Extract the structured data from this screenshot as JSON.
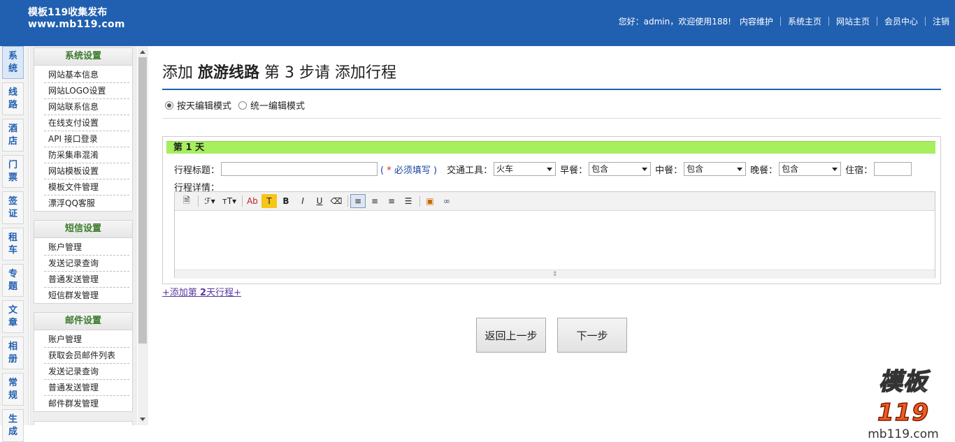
{
  "header": {
    "logo_line1": "模板119收集发布",
    "logo_line2": "www.mb119.com",
    "greeting": "您好：admin，欢迎使用188!",
    "nav": [
      "内容维护",
      "系统主页",
      "网站主页",
      "会员中心",
      "注销"
    ]
  },
  "vtabs": [
    "系统",
    "线路",
    "酒店",
    "门票",
    "签证",
    "租车",
    "专题",
    "文章",
    "相册",
    "常规",
    "生成"
  ],
  "menu": {
    "groups": [
      {
        "title": "系统设置",
        "items": [
          "网站基本信息",
          "网站LOGO设置",
          "网站联系信息",
          "在线支付设置",
          "API 接口登录",
          "防采集串混淆",
          "网站模板设置",
          "模板文件管理",
          "漂浮QQ客服"
        ]
      },
      {
        "title": "短信设置",
        "items": [
          "账户管理",
          "发送记录查询",
          "普通发送管理",
          "短信群发管理"
        ]
      },
      {
        "title": "邮件设置",
        "items": [
          "账户管理",
          "获取会员邮件列表",
          "发送记录查询",
          "普通发送管理",
          "邮件群发管理"
        ]
      }
    ]
  },
  "main": {
    "title_pre": "添加",
    "title_bold": "旅游线路",
    "title_post": "第 3 步请 添加行程",
    "mode_day": "按天编辑模式",
    "mode_all": "统一编辑模式",
    "day_head": "第 1 天",
    "field_title": "行程标题：",
    "req_star": "*",
    "req_text": "必须填写",
    "req_open": "(",
    "req_close": ")",
    "transport_label": "交通工具：",
    "transport_value": "火车",
    "breakfast_label": "早餐：",
    "breakfast_value": "包含",
    "lunch_label": "中餐：",
    "lunch_value": "包含",
    "dinner_label": "晚餐：",
    "dinner_value": "包含",
    "stay_label": "住宿：",
    "detail_label": "行程详情：",
    "add_day_pre": "+添加第 ",
    "add_day_num": "2",
    "add_day_post": "天行程+",
    "btn_prev": "返回上一步",
    "btn_next": "下一步"
  },
  "watermark": {
    "brand": "模板",
    "num": "119",
    "site": "mb119.com"
  }
}
